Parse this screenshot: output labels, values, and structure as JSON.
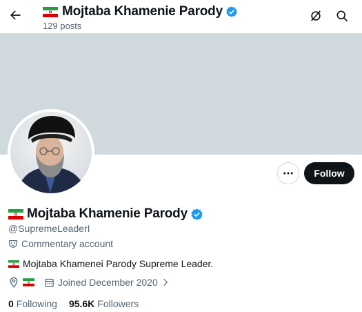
{
  "header": {
    "title": "Mojtaba Khamenie Parody",
    "post_count": "129 posts"
  },
  "profile": {
    "display_name": "Mojtaba Khamenie Parody",
    "handle": "@SupremeLeaderI",
    "parody_label": "Commentary account",
    "bio": "Mojtaba Khamenei Parody Supreme Leader.",
    "joined": "Joined December 2020",
    "following_count": "0",
    "following_label": "Following",
    "followers_count": "95.6K",
    "followers_label": "Followers"
  },
  "actions": {
    "follow_label": "Follow"
  },
  "colors": {
    "banner": "#cfd9de",
    "verified_blue": "#1d9bf0",
    "flag_green": "#239f40",
    "flag_red": "#da0000",
    "follow_button": "#0f1419"
  },
  "icons": [
    "back-arrow-icon",
    "grok-icon",
    "search-icon",
    "verified-badge-icon",
    "more-icon",
    "parody-mask-icon",
    "location-icon",
    "calendar-icon",
    "chevron-right-icon",
    "iran-flag-icon"
  ]
}
